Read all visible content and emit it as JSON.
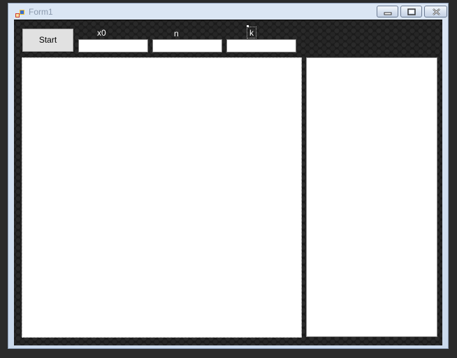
{
  "window": {
    "title": "Form1",
    "icon": "app-icon",
    "caption_buttons": [
      "minimize-icon",
      "restore-icon",
      "close-icon"
    ]
  },
  "toolbar": {
    "start_label": "Start",
    "fields": [
      {
        "label": "x0",
        "value": ""
      },
      {
        "label": "n",
        "value": ""
      },
      {
        "label": "k",
        "value": ""
      }
    ]
  },
  "colors": {
    "background": "#1b1b1b",
    "panel": "#ffffff",
    "label_text": "#ffffff"
  }
}
